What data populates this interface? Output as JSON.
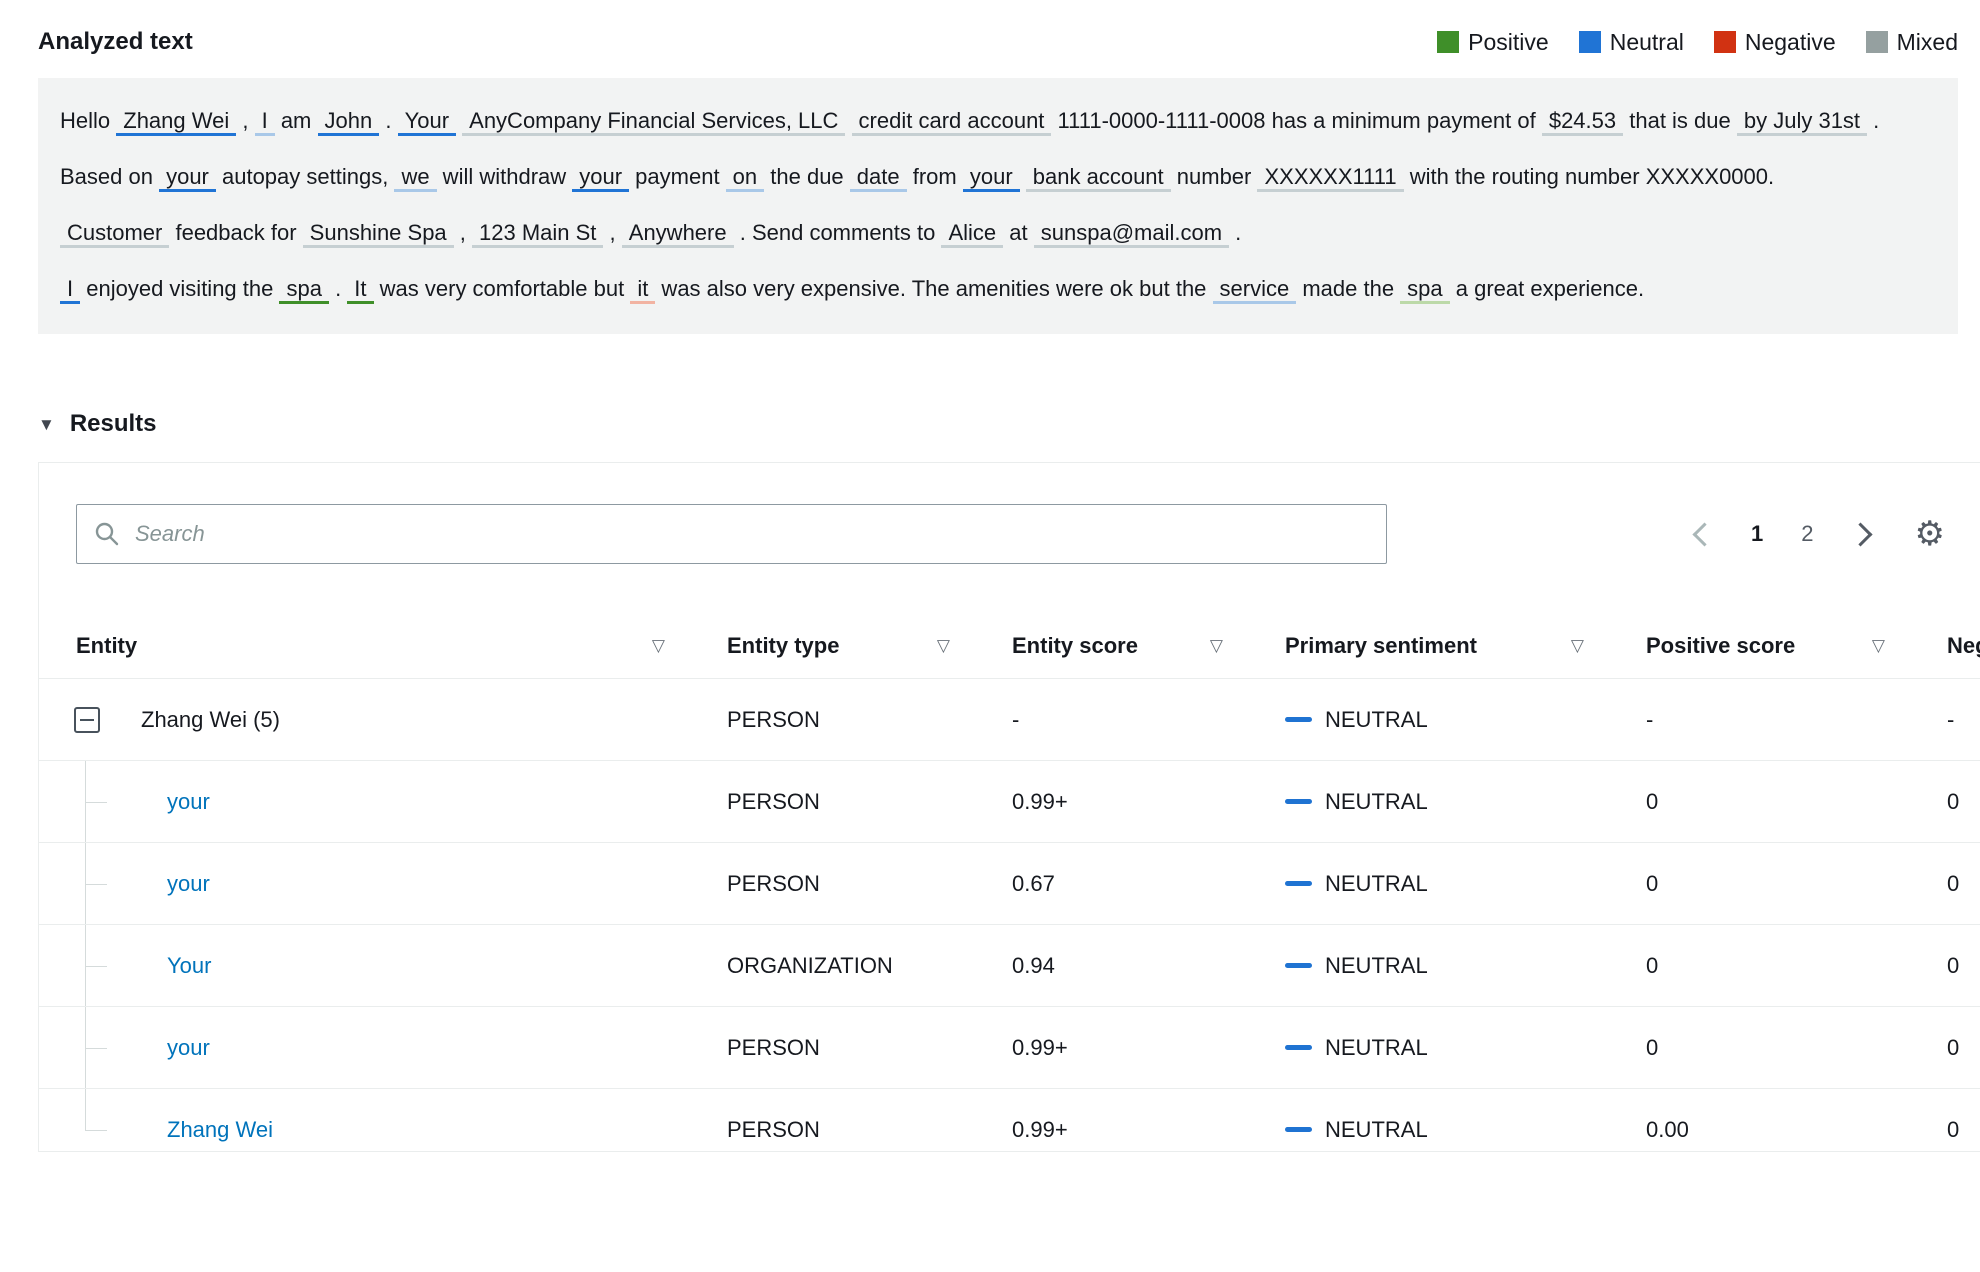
{
  "header": {
    "title": "Analyzed text",
    "legend": [
      {
        "label": "Positive",
        "color": "#3f8f29"
      },
      {
        "label": "Neutral",
        "color": "#2074d5"
      },
      {
        "label": "Negative",
        "color": "#d13212"
      },
      {
        "label": "Mixed",
        "color": "#95a0a0"
      }
    ]
  },
  "analyzed_text": {
    "paragraphs": [
      {
        "segments": [
          {
            "text": "Hello "
          },
          {
            "text": "Zhang Wei",
            "mark": "neutral"
          },
          {
            "text": " , "
          },
          {
            "text": "I",
            "mark": "neutral-light"
          },
          {
            "text": " am "
          },
          {
            "text": "John",
            "mark": "neutral"
          },
          {
            "text": " . "
          },
          {
            "text": "Your",
            "mark": "neutral"
          },
          {
            "text": " "
          },
          {
            "text": "AnyCompany Financial Services, LLC",
            "mark": "gray"
          },
          {
            "text": " "
          },
          {
            "text": "credit card account",
            "mark": "gray"
          },
          {
            "text": " 1111-0000-1111-0008 has a minimum payment of "
          },
          {
            "text": "$24.53",
            "mark": "gray"
          },
          {
            "text": " that is due "
          },
          {
            "text": "by July 31st",
            "mark": "gray"
          },
          {
            "text": " . Based on "
          },
          {
            "text": "your",
            "mark": "neutral"
          },
          {
            "text": " autopay settings, "
          },
          {
            "text": "we",
            "mark": "neutral-light"
          },
          {
            "text": " will withdraw "
          },
          {
            "text": "your",
            "mark": "neutral"
          },
          {
            "text": " payment "
          },
          {
            "text": "on",
            "mark": "neutral-light"
          },
          {
            "text": " the due "
          },
          {
            "text": "date",
            "mark": "neutral-light"
          },
          {
            "text": " from "
          },
          {
            "text": "your",
            "mark": "neutral"
          },
          {
            "text": " "
          },
          {
            "text": "bank account",
            "mark": "gray"
          },
          {
            "text": " number "
          },
          {
            "text": "XXXXXX1111",
            "mark": "gray"
          },
          {
            "text": " with the routing number XXXXX0000."
          }
        ]
      },
      {
        "segments": [
          {
            "text": "Customer",
            "mark": "gray"
          },
          {
            "text": " feedback for "
          },
          {
            "text": "Sunshine Spa",
            "mark": "gray"
          },
          {
            "text": " , "
          },
          {
            "text": "123 Main St",
            "mark": "gray"
          },
          {
            "text": " , "
          },
          {
            "text": "Anywhere",
            "mark": "gray"
          },
          {
            "text": " . Send comments to "
          },
          {
            "text": "Alice",
            "mark": "gray"
          },
          {
            "text": " at "
          },
          {
            "text": "sunspa@mail.com",
            "mark": "gray"
          },
          {
            "text": " ."
          }
        ]
      },
      {
        "segments": [
          {
            "text": "I",
            "mark": "neutral"
          },
          {
            "text": " enjoyed visiting the "
          },
          {
            "text": "spa",
            "mark": "positive"
          },
          {
            "text": " . "
          },
          {
            "text": "It",
            "mark": "positive"
          },
          {
            "text": " was very comfortable but "
          },
          {
            "text": "it",
            "mark": "negative-light"
          },
          {
            "text": " was also very expensive. The amenities were ok but the "
          },
          {
            "text": "service",
            "mark": "neutral-light"
          },
          {
            "text": " made the "
          },
          {
            "text": "spa",
            "mark": "positive-light"
          },
          {
            "text": " a great experience."
          }
        ]
      }
    ]
  },
  "results": {
    "title": "Results",
    "search": {
      "placeholder": "Search"
    },
    "pagination": {
      "pages": [
        "1",
        "2"
      ],
      "current": "1"
    },
    "table": {
      "columns": [
        "Entity",
        "Entity type",
        "Entity score",
        "Primary sentiment",
        "Positive score",
        "Negative score"
      ],
      "rows": [
        {
          "entity": "Zhang Wei (5)",
          "type": "PERSON",
          "score": "-",
          "sentiment": "NEUTRAL",
          "positive": "-",
          "negative": "-",
          "level": "parent"
        },
        {
          "entity": "your",
          "type": "PERSON",
          "score": "0.99+",
          "sentiment": "NEUTRAL",
          "positive": "0",
          "negative": "0",
          "level": "child"
        },
        {
          "entity": "your",
          "type": "PERSON",
          "score": "0.67",
          "sentiment": "NEUTRAL",
          "positive": "0",
          "negative": "0",
          "level": "child"
        },
        {
          "entity": "Your",
          "type": "ORGANIZATION",
          "score": "0.94",
          "sentiment": "NEUTRAL",
          "positive": "0",
          "negative": "0",
          "level": "child"
        },
        {
          "entity": "your",
          "type": "PERSON",
          "score": "0.99+",
          "sentiment": "NEUTRAL",
          "positive": "0",
          "negative": "0",
          "level": "child"
        },
        {
          "entity": "Zhang Wei",
          "type": "PERSON",
          "score": "0.99+",
          "sentiment": "NEUTRAL",
          "positive": "0.00",
          "negative": "0",
          "level": "child",
          "last": true
        }
      ]
    }
  }
}
